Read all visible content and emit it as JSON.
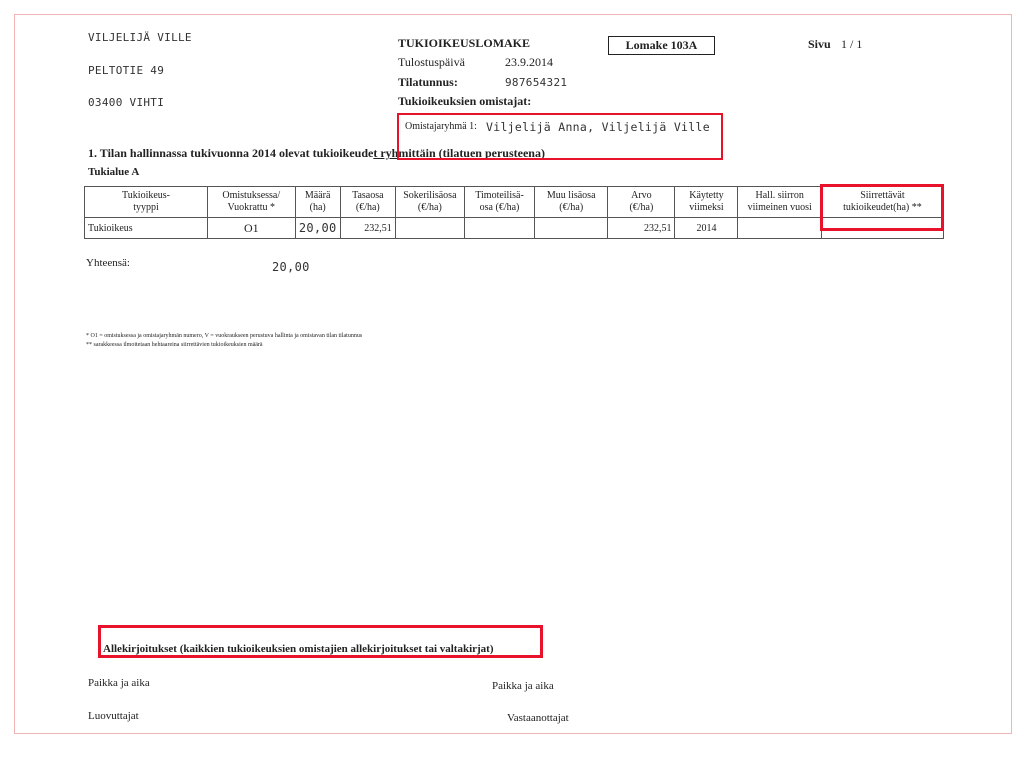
{
  "sender": {
    "name": "VILJELIJÄ VILLE",
    "street": "PELTOTIE 49",
    "postal": "03400 VIHTI"
  },
  "header": {
    "form_title": "TUKIOIKEUSLOMAKE",
    "form_code": "Lomake 103A",
    "page_label": "Sivu",
    "page_value": "1 / 1",
    "print_date_label": "Tulostuspäivä",
    "print_date": "23.9.2014",
    "farm_id_label": "Tilatunnus:",
    "farm_id": "987654321",
    "owners_label": "Tukioikeuksien omistajat:",
    "owner_group_label": "Omistajaryhmä 1:",
    "owner_group_names": "Viljelijä Anna, Viljelijä Ville"
  },
  "section1": {
    "title_part1": "1. Tilan hallinnassa tukivuonna 2014 olevat tukioikeude",
    "title_part2": "t ryhmittäin (tilatuen perusteena)",
    "area": "Tukialue A"
  },
  "table": {
    "headers": [
      "Tukioikeus-\ntyyppi",
      "Omistuksessa/\nVuokrattu *",
      "Määrä\n(ha)",
      "Tasaosa\n(€/ha)",
      "Sokerilisäosa\n(€/ha)",
      "Timoteilisä-\nosa (€/ha)",
      "Muu lisäosa\n(€/ha)",
      "Arvo\n(€/ha)",
      "Käytetty\nviimeksi",
      "Hall. siirron\nviimeinen vuosi",
      "Siirrettävät\ntukioikeudet(ha) **"
    ],
    "row": {
      "type": "Tukioikeus",
      "ownership": "O1",
      "amount": "20,00",
      "flat": "232,51",
      "sugar": "",
      "timothy": "",
      "other": "",
      "value": "232,51",
      "last_used": "2014",
      "transfer_year": "",
      "transferable": ""
    },
    "total_label": "Yhteensä:",
    "total_amount": "20,00"
  },
  "footnotes": {
    "note1": "* O1 = omistuksessa ja omistajaryhmän numero, V = vuokraukseen perustuva hallinta ja omistavan tilan tilatunnus",
    "note2": "** sarakkeessa ilmoitetaan hehtaareina siirrettävien tukioikeuksien määrä"
  },
  "signatures": {
    "title": "Allekirjoitukset (kaikkien tukioikeuksien omistajien allekirjoitukset tai valtakirjat)",
    "place_time_left": "Paikka ja aika",
    "place_time_right": "Paikka ja aika",
    "givers": "Luovuttajat",
    "receivers": "Vastaanottajat"
  },
  "highlight_color": "#e8132a"
}
